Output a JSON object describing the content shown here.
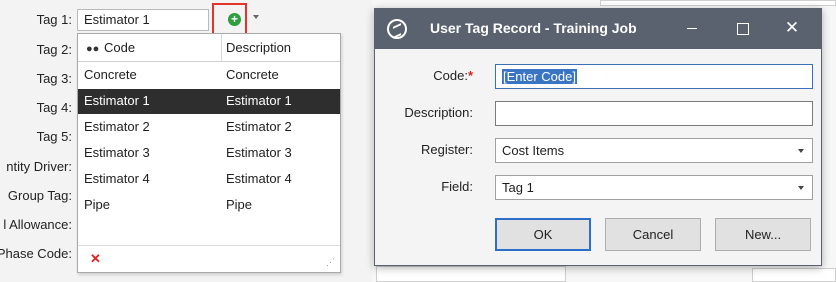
{
  "background_form": {
    "tag1_label": "Tag 1:",
    "tag1_value": "Estimator 1",
    "labels": [
      "Tag 2:",
      "Tag 3:",
      "Tag 4:",
      "Tag 5:",
      "ntity Driver:",
      "Group Tag:",
      "l Allowance:",
      "Phase Code:"
    ]
  },
  "dropdown": {
    "header_code": "Code",
    "header_description": "Description",
    "rows": [
      {
        "code": "Concrete",
        "description": "Concrete"
      },
      {
        "code": "Estimator 1",
        "description": "Estimator 1"
      },
      {
        "code": "Estimator 2",
        "description": "Estimator 2"
      },
      {
        "code": "Estimator 3",
        "description": "Estimator 3"
      },
      {
        "code": "Estimator 4",
        "description": "Estimator 4"
      },
      {
        "code": "Pipe",
        "description": "Pipe"
      }
    ],
    "selected_index": 1,
    "close_glyph": "✕",
    "grip_glyph": "⋰"
  },
  "add_icon_glyph": "+",
  "dialog": {
    "title": "User Tag Record - Training Job",
    "close_glyph": "✕",
    "code_label": "Code:",
    "required_mark": "*",
    "code_value": "[Enter Code]",
    "description_label": "Description:",
    "description_value": "",
    "register_label": "Register:",
    "register_value": "Cost Items",
    "field_label": "Field:",
    "field_value": "Tag 1",
    "ok_label": "OK",
    "cancel_label": "Cancel",
    "new_label": "New..."
  },
  "colors": {
    "titlebar": "#5a6270",
    "selected_row": "#2e2e2e",
    "highlight_box": "#e0342c",
    "add_icon": "#2e9e3e",
    "primary_border": "#2b6fc9"
  }
}
